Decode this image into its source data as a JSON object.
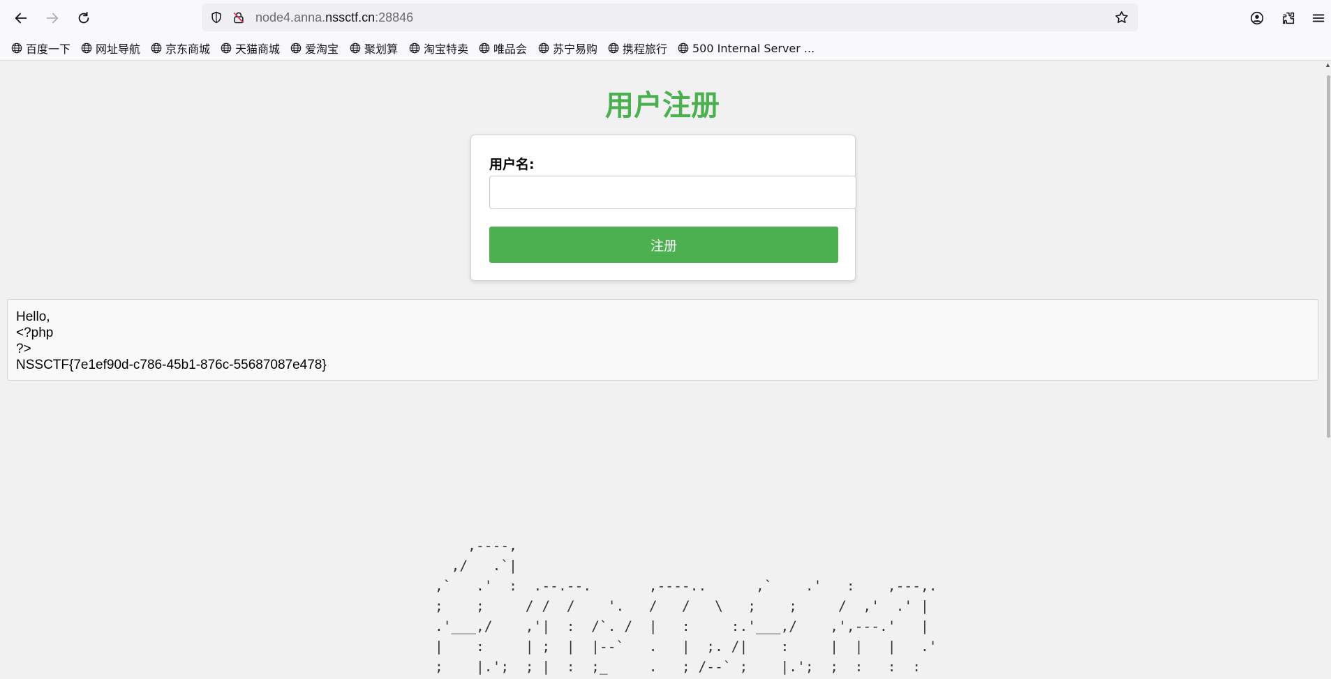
{
  "browser": {
    "url_prefix": "node4.anna.",
    "url_domain": "nssctf.cn",
    "url_suffix": ":28846",
    "bookmarks": [
      {
        "label": "百度一下",
        "icon": "globe-icon"
      },
      {
        "label": "网址导航",
        "icon": "globe-icon"
      },
      {
        "label": "京东商城",
        "icon": "globe-icon"
      },
      {
        "label": "天猫商城",
        "icon": "globe-icon"
      },
      {
        "label": "爱淘宝",
        "icon": "globe-icon"
      },
      {
        "label": "聚划算",
        "icon": "globe-icon"
      },
      {
        "label": "淘宝特卖",
        "icon": "globe-icon"
      },
      {
        "label": "唯品会",
        "icon": "globe-icon"
      },
      {
        "label": "苏宁易购",
        "icon": "globe-icon"
      },
      {
        "label": "携程旅行",
        "icon": "globe-icon"
      },
      {
        "label": "500 Internal Server ...",
        "icon": "globe-icon"
      }
    ]
  },
  "page": {
    "title": "用户注册",
    "title_color": "#4caf50",
    "form": {
      "username_label": "用户名:",
      "username_value": "",
      "submit_label": "注册",
      "button_color": "#4caf50"
    },
    "output": {
      "lines": [
        "Hello,",
        "<?php",
        "?>",
        "NSSCTF{7e1ef90d-c786-45b1-876c-55687087e478}"
      ]
    },
    "ascii_art": "    ,----,\n  ,/   .`|\n,`   .'  :  .--.--.       ,----..      ,`    .'   :    ,---,.\n;    ;     / /  /    '.   /   /   \\   ;    ;     /  ,'  .' |\n.'___,/    ,'|  :  /`. /  |   :     :.'___,/    ,',---.'   |\n|    :     | ;  |  |--`   .   |  ;. /|    :     |  |   |   .'\n;    |.';  ; |  :  ;_     .   ; /--` ;    |.';  ;  :   :  :"
  }
}
